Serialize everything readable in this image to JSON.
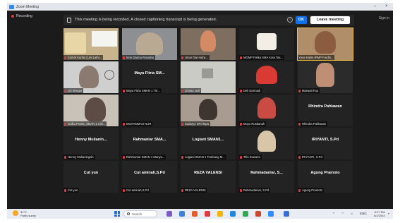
{
  "window": {
    "title": "Zoom Meeting",
    "sign_in_label": "Sign in"
  },
  "recording": {
    "label": "Recording"
  },
  "notice": {
    "message": "This meeting is being recorded. A closed captioning transcript is being generated.",
    "info_label": "i",
    "ok_label": "OK",
    "leave_label": "Leave meeting"
  },
  "participants": [
    {
      "name": "SLB-B Kartini (Leti Lathi...",
      "tile_name": ""
    },
    {
      "name": "Inne Darma Rosalina",
      "tile_name": ""
    },
    {
      "name": "Umar Dwi Indra...",
      "tile_name": ""
    },
    {
      "name": "MGMP Fisika SMA Kota Tas...",
      "tile_name": ""
    },
    {
      "name": "Yana Halim (PMP Fardhi...",
      "tile_name": ""
    },
    {
      "name": "Lin Siregar",
      "tile_name": ""
    },
    {
      "name": "Maya Fitria SMKN 1 Tirt...",
      "tile_name": "Maya Fitria SM..."
    },
    {
      "name": "Lineau Jedi",
      "tile_name": ""
    },
    {
      "name": "Deli Darmadi",
      "tile_name": ""
    },
    {
      "name": "Marwati Fau",
      "tile_name": ""
    },
    {
      "name": "Gulka Pratiw_SMAN 1 Cisi...",
      "tile_name": ""
    },
    {
      "name": "MUHAMMAD NUR",
      "tile_name": ""
    },
    {
      "name": "Sudaryo SPd Mpa",
      "tile_name": ""
    },
    {
      "name": "Moyo Rustianah",
      "tile_name": ""
    },
    {
      "name": "Rhindra Pahlawan",
      "tile_name": "Rhindra Pahlawan"
    },
    {
      "name": "Henny Mulianingsih",
      "tile_name": "Henny Mulianin..."
    },
    {
      "name": "Rahmaniar SMAN 1 Manyu...",
      "tile_name": "Rahmaniar SMA..."
    },
    {
      "name": "Logiani SMAN 1 Tombang M...",
      "tile_name": "Logiani SMAN1..."
    },
    {
      "name": "Tilin Suwarni",
      "tile_name": ""
    },
    {
      "name": "IRIYANTI, S.Pd",
      "tile_name": "IRIYANTI, S.Pd"
    },
    {
      "name": "Cut yun",
      "tile_name": "Cut yun"
    },
    {
      "name": "Cut aminah,S.Pd",
      "tile_name": "Cut aminah,S.Pd"
    },
    {
      "name": "REZA VALENSI",
      "tile_name": "REZA VALENSI"
    },
    {
      "name": "Rahmadaniar, S.Pd",
      "tile_name": "Rahmadaniar, S..."
    },
    {
      "name": "Agung Pramoto",
      "tile_name": "Agung Pramoto"
    }
  ],
  "taskbar": {
    "weather_temp": "31°C",
    "weather_desc": "Partly sunny",
    "search_label": "Search",
    "tray_text": "ENG",
    "time": "3:17 PM",
    "date": "5/1/2024"
  },
  "colors": {
    "recording_dot": "#e0393e",
    "ok_button": "#0e72ed",
    "active_speaker_border": "#f2c64d",
    "muted_mic": "#e0393e"
  }
}
